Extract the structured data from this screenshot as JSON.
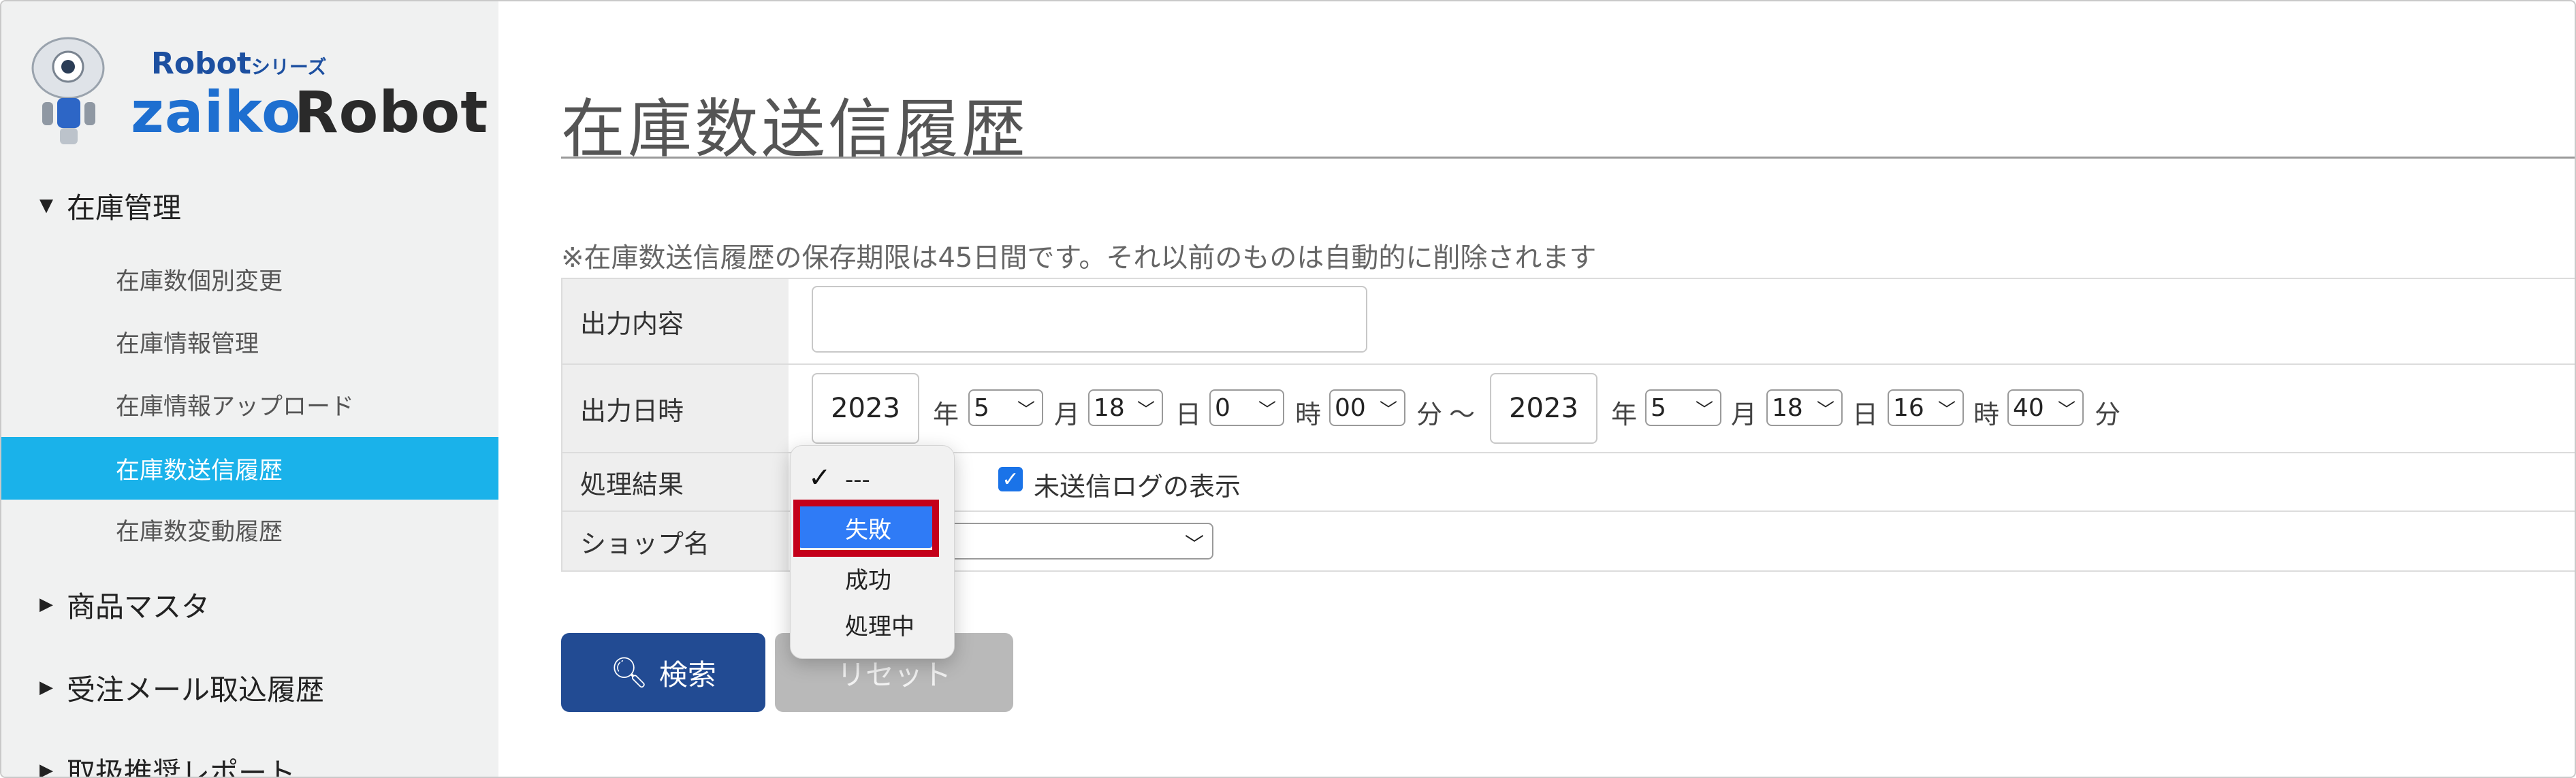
{
  "logo": {
    "series": "Robot",
    "series_suffix": "シリーズ",
    "name_left": "zaiko",
    "name_right": "Robot"
  },
  "sidebar": {
    "groups": [
      {
        "label": "在庫管理"
      },
      {
        "label": "商品マスタ"
      },
      {
        "label": "受注メール取込履歴"
      },
      {
        "label": "取扱推奨レポート"
      }
    ],
    "items": [
      {
        "label": "在庫数個別変更"
      },
      {
        "label": "在庫情報管理"
      },
      {
        "label": "在庫情報アップロード"
      },
      {
        "label": "在庫数送信履歴"
      },
      {
        "label": "在庫数変動履歴"
      }
    ]
  },
  "page": {
    "title": "在庫数送信履歴",
    "notice": "※在庫数送信履歴の保存期限は45日間です。それ以前のものは自動的に削除されます"
  },
  "form": {
    "output_label": "出力内容",
    "date_label": "出力日時",
    "result_label": "処理結果",
    "shop_label": "ショップ名",
    "from": {
      "year": "2023",
      "month": "5",
      "day": "18",
      "hour": "0",
      "minute": "00"
    },
    "to": {
      "year": "2023",
      "month": "5",
      "day": "18",
      "hour": "16",
      "minute": "40"
    },
    "units": {
      "year": "年",
      "month": "月",
      "day": "日",
      "hour": "時",
      "minute": "分",
      "tilde": "〜"
    },
    "checkbox_label": "未送信ログの表示"
  },
  "dropdown": {
    "options": [
      "---",
      "失敗",
      "成功",
      "処理中"
    ],
    "checked": "---",
    "highlighted": "失敗"
  },
  "buttons": {
    "search": "検索",
    "reset": "リセット"
  },
  "colors": {
    "active": "#1ab2ea",
    "search_button": "#224b93",
    "highlight": "#2f7bf6",
    "annotation": "#c4001a"
  }
}
